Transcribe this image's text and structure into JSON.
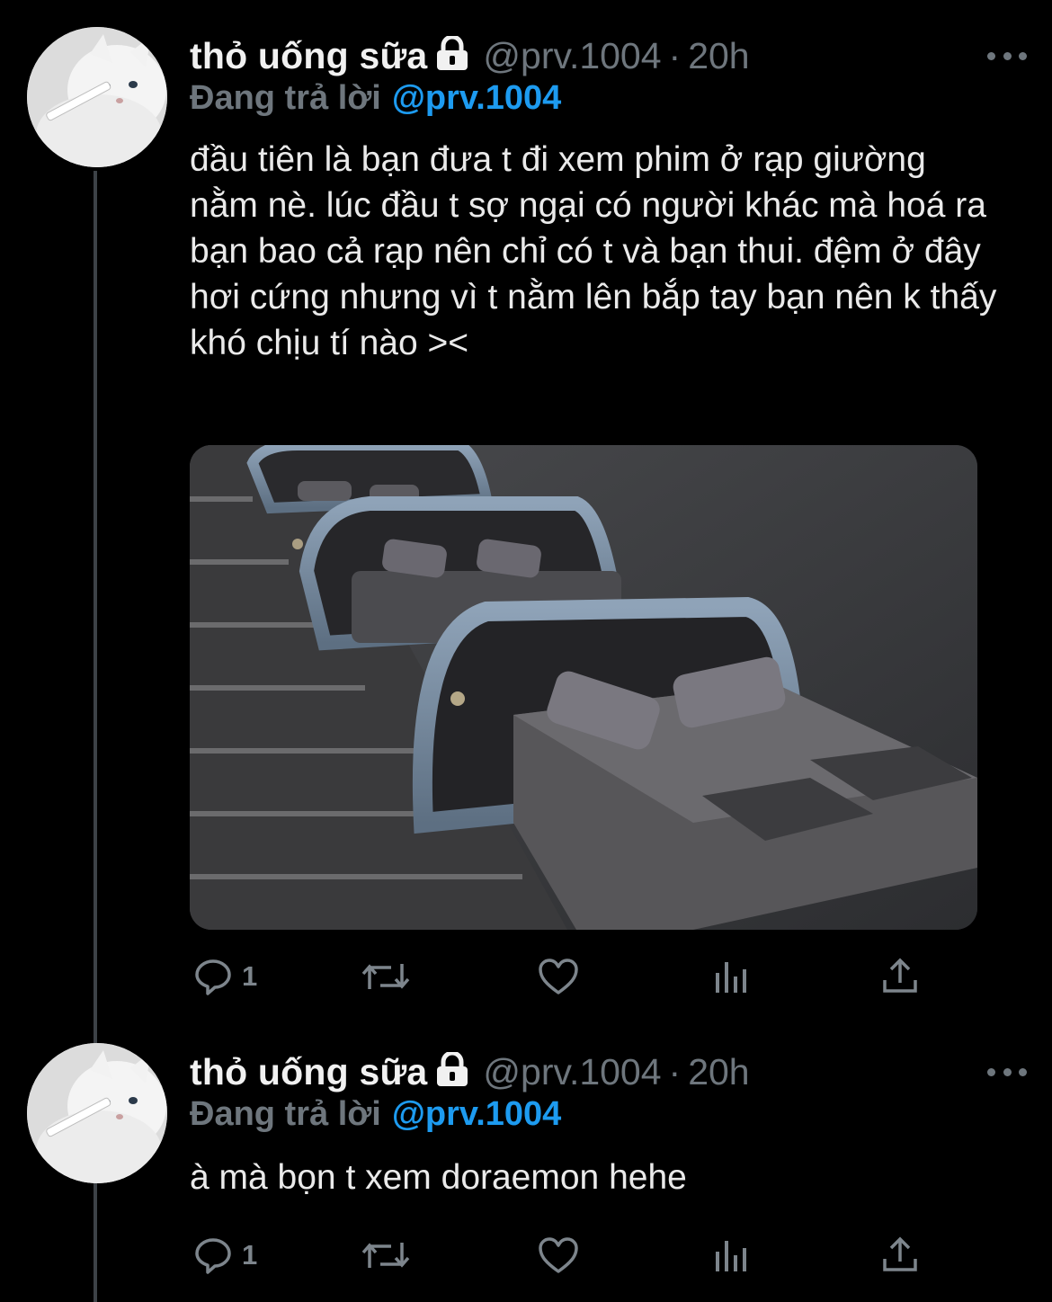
{
  "tweets": [
    {
      "author": "thỏ uống sữa",
      "handle": "@prv.1004",
      "separator": "·",
      "time": "20h",
      "reply_label": "Đang trả lời",
      "reply_to": "@prv.1004",
      "text": "đầu tiên là bạn đưa t đi xem phim ở rạp giường nằm nè. lúc đầu t sợ ngại có người khác mà hoá ra bạn bao cả rạp nên chỉ có t và bạn thui. đệm ở đây hơi cứng nhưng vì t nằm lên bắp tay bạn nên k thấy khó chịu tí nào ><",
      "has_media": true,
      "reply_count": "1"
    },
    {
      "author": "thỏ uống sữa",
      "handle": "@prv.1004",
      "separator": "·",
      "time": "20h",
      "reply_label": "Đang trả lời",
      "reply_to": "@prv.1004",
      "text": "à mà bọn t xem doraemon hehe",
      "has_media": false,
      "reply_count": "1"
    }
  ],
  "icons": {
    "verified_lock": "lock-icon",
    "more": "more-icon",
    "reply": "reply-icon",
    "retweet": "retweet-icon",
    "like": "like-icon",
    "analytics": "analytics-icon",
    "share": "share-icon"
  },
  "colors": {
    "background": "#000000",
    "link": "#1d9bf0",
    "muted": "#6e767d",
    "text": "#eaeaea"
  }
}
